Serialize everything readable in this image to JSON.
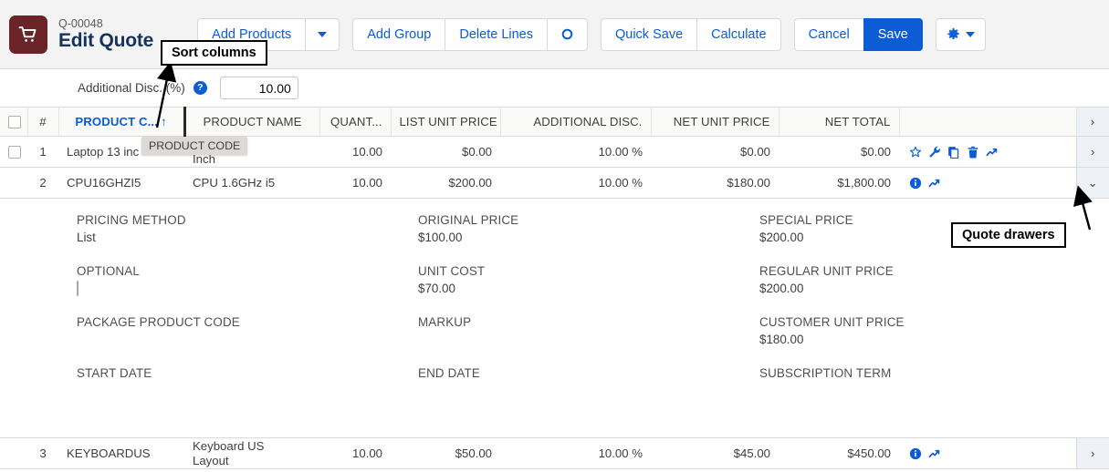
{
  "header": {
    "record_id": "Q-00048",
    "title": "Edit Quote",
    "logo_icon": "shopping-cart-icon",
    "logo_color": "#6a2326"
  },
  "toolbar": {
    "accent_color": "#0b5cd5",
    "add_products": "Add Products",
    "add_products_caret": "caret-down-icon",
    "add_group": "Add Group",
    "delete_lines": "Delete Lines",
    "refresh_icon": "circle-icon",
    "quick_save": "Quick Save",
    "calculate": "Calculate",
    "cancel": "Cancel",
    "save": "Save",
    "settings_icon": "gear-icon",
    "settings_caret": "caret-down-icon"
  },
  "subbar": {
    "label": "Additional Disc. (%)",
    "help_icon": "help-circle-icon",
    "value": "10.00",
    "placeholder": "0.00"
  },
  "table": {
    "columns": [
      {
        "key": "chk",
        "label": "",
        "align": "ctr"
      },
      {
        "key": "idx",
        "label": "#",
        "align": "ctr"
      },
      {
        "key": "code",
        "label": "PRODUCT C...",
        "align": "left",
        "sorted": true,
        "sort_arrow": "↑"
      },
      {
        "key": "name",
        "label": "PRODUCT NAME",
        "align": "left"
      },
      {
        "key": "qty",
        "label": "QUANT...",
        "align": "num"
      },
      {
        "key": "lup",
        "label": "LIST UNIT PRICE",
        "align": "num"
      },
      {
        "key": "adisc",
        "label": "ADDITIONAL DISC.",
        "align": "num"
      },
      {
        "key": "nup",
        "label": "NET UNIT PRICE",
        "align": "num"
      },
      {
        "key": "ntot",
        "label": "NET TOTAL",
        "align": "num"
      },
      {
        "key": "act",
        "label": "",
        "align": "left"
      },
      {
        "key": "exp",
        "label": "›",
        "align": "ctr"
      }
    ],
    "rows": [
      {
        "idx": "1",
        "code": "Laptop 13 inc",
        "name": "top 13",
        "name2": "Inch",
        "qty": "10.00",
        "lup": "$0.00",
        "adisc": "10.00 %",
        "nup": "$0.00",
        "ntot": "$0.00",
        "checkbox": true,
        "icons": [
          "star-icon",
          "wrench-icon",
          "copy-icon",
          "trash-icon",
          "trend-up-icon"
        ],
        "expand": "›",
        "expanded": false
      },
      {
        "idx": "2",
        "code": "CPU16GHZI5",
        "name": "CPU 1.6GHz i5",
        "name2": "",
        "qty": "10.00",
        "lup": "$200.00",
        "adisc": "10.00 %",
        "nup": "$180.00",
        "ntot": "$1,800.00",
        "checkbox": false,
        "icons": [
          "info-icon",
          "trend-up-icon"
        ],
        "expand": "⌄",
        "expanded": true
      },
      {
        "idx": "3",
        "code": "KEYBOARDUS",
        "name": "Keyboard US",
        "name2": "Layout",
        "qty": "10.00",
        "lup": "$50.00",
        "adisc": "10.00 %",
        "nup": "$45.00",
        "ntot": "$450.00",
        "checkbox": false,
        "icons": [
          "info-icon",
          "trend-up-icon"
        ],
        "expand": "›",
        "expanded": false
      }
    ]
  },
  "drawer": {
    "fields": [
      {
        "label": "PRICING METHOD",
        "value": "List"
      },
      {
        "label": "ORIGINAL PRICE",
        "value": "$100.00"
      },
      {
        "label": "SPECIAL PRICE",
        "value": "$200.00"
      },
      {
        "label": "OPTIONAL",
        "value": "",
        "type": "checkbox"
      },
      {
        "label": "UNIT COST",
        "value": "$70.00"
      },
      {
        "label": "REGULAR UNIT PRICE",
        "value": "$200.00"
      },
      {
        "label": "PACKAGE PRODUCT CODE",
        "value": ""
      },
      {
        "label": "MARKUP",
        "value": ""
      },
      {
        "label": "CUSTOMER UNIT PRICE",
        "value": "$180.00"
      },
      {
        "label": "START DATE",
        "value": ""
      },
      {
        "label": "END DATE",
        "value": ""
      },
      {
        "label": "SUBSCRIPTION TERM",
        "value": ""
      }
    ]
  },
  "annotations": {
    "sort_columns": "Sort columns",
    "quote_drawers": "Quote drawers"
  },
  "tooltip": {
    "text": "PRODUCT CODE"
  }
}
